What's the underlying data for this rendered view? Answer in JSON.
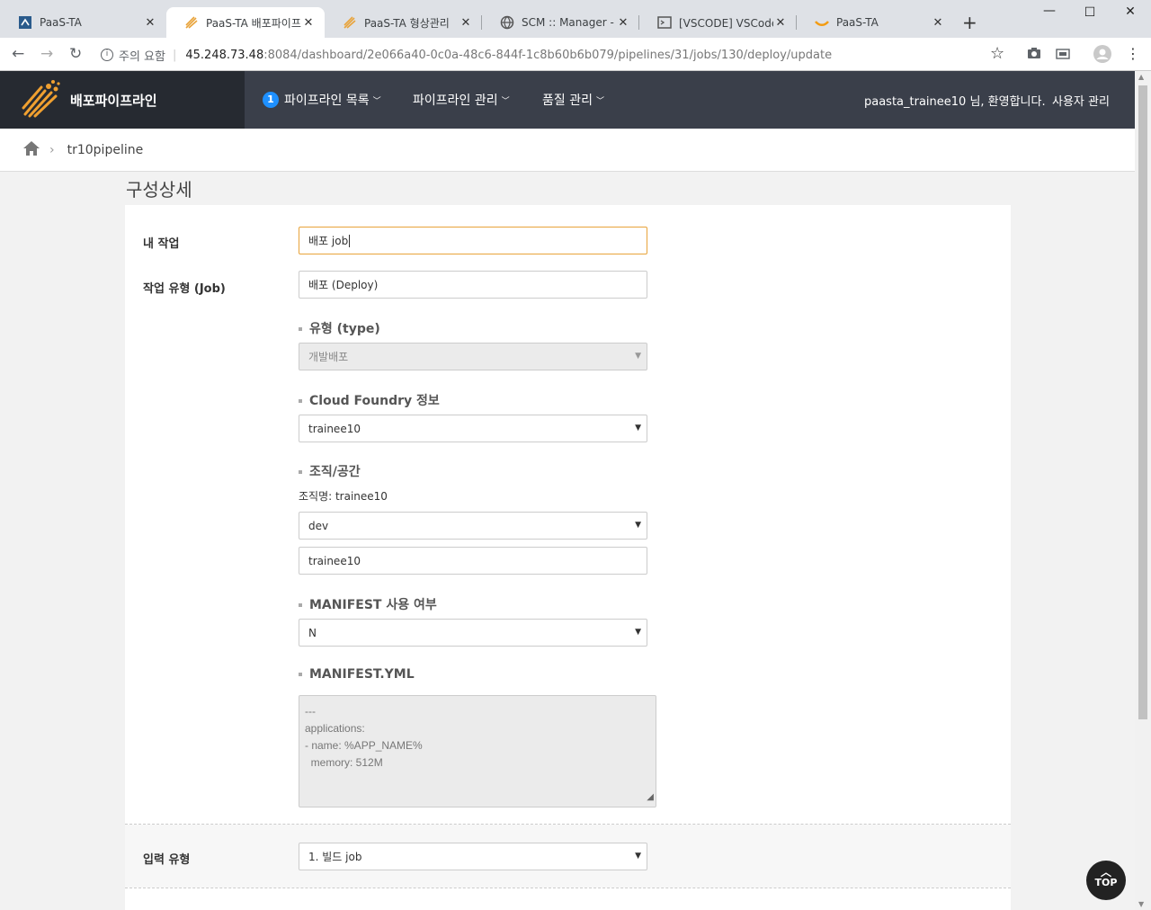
{
  "browser": {
    "tabs": [
      {
        "title": "PaaS-TA"
      },
      {
        "title": "PaaS-TA 배포파이프"
      },
      {
        "title": "PaaS-TA 형상관리"
      },
      {
        "title": "SCM :: Manager - Gi"
      },
      {
        "title": "[VSCODE] VSCode에"
      },
      {
        "title": "PaaS-TA"
      }
    ],
    "security_label": "주의 요함",
    "url_host": "45.248.73.48",
    "url_rest": ":8084/dashboard/2e066a40-0c0a-48c6-844f-1c8b60b6b079/pipelines/31/jobs/130/deploy/update"
  },
  "app": {
    "logo_text": "배포파이프라인",
    "menu": [
      {
        "badge": "1",
        "label": "파이프라인 목록"
      },
      {
        "label": "파이프라인 관리"
      },
      {
        "label": "품질 관리"
      }
    ],
    "welcome": "paasta_trainee10 님, 환영합니다.",
    "user_admin": "사용자 관리"
  },
  "breadcrumb": {
    "pipeline": "tr10pipeline"
  },
  "page_title": "구성상세",
  "form": {
    "my_job_label": "내 작업",
    "my_job_value": "배포 job",
    "job_type_label": "작업 유형 (Job)",
    "job_type_value": "배포 (Deploy)",
    "type_label": "유형 (type)",
    "type_value": "개발배포",
    "cf_label": "Cloud Foundry 정보",
    "cf_value": "trainee10",
    "org_label": "조직/공간",
    "org_name": "조직명: trainee10",
    "space_value": "dev",
    "app_value": "trainee10",
    "manifest_use_label": "MANIFEST 사용 여부",
    "manifest_use_value": "N",
    "manifest_yml_label": "MANIFEST.YML",
    "manifest_yml": "---\napplications:\n- name: %APP_NAME%\n  memory: 512M",
    "input_type_label": "입력 유형",
    "input_type_value": "1. 빌드 job"
  },
  "top_button": "TOP",
  "colors": {
    "nav_bg": "#3a3f4a",
    "logo_bg": "#262a31",
    "badge": "#1e90ff",
    "focus": "#e8a33a"
  }
}
